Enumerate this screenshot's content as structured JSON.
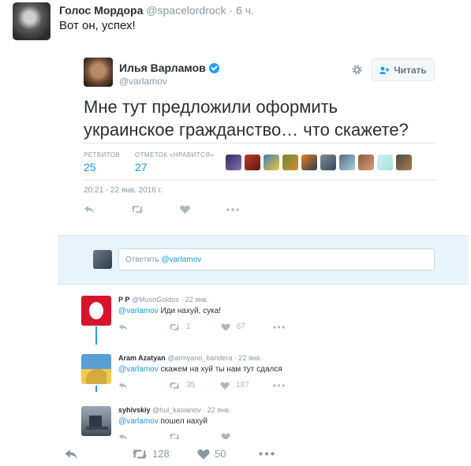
{
  "outer_tweet": {
    "name": "Голос Мордора",
    "handle": "@spacelordrock",
    "time": "· 6 ч.",
    "text": "Вот он, успех!",
    "retweets": "128",
    "likes": "50"
  },
  "embedded": {
    "author_name": "Илья Варламов",
    "author_handle": "@varlamov",
    "follow_label": "Читать",
    "text": "Мне тут предложили оформить украинское гражданство… что скажете?",
    "retweets_label": "РЕТВИТОВ",
    "retweets_value": "25",
    "likes_label": "ОТМЕТОК «НРАВИТСЯ»",
    "likes_value": "27",
    "timestamp": "20:21 - 22 янв. 2016 г.",
    "composer_prefix": "Ответить ",
    "composer_mention": "@varlamov"
  },
  "replies": [
    {
      "name": "Р Р",
      "handle": "@MusoGoldos · 22 янв.",
      "mention": "@varlamov",
      "text": " Иди нахуй, сука!",
      "retweets": "1",
      "likes": "67"
    },
    {
      "name": "Aram Azatyan",
      "handle": "@armyano_bandera · 22 янв.",
      "mention": "@varlamov",
      "text": " скажем на хуй ты нам тут сдался",
      "retweets": "35",
      "likes": "187"
    },
    {
      "name": "syhivskiy",
      "handle": "@hui_kasianov · 22 янв.",
      "mention": "@varlamov",
      "text": " пошел нахуй",
      "retweets": "",
      "likes": ""
    }
  ],
  "colors": {
    "link": "#1b95e0",
    "muted": "#8899a6",
    "composer_bg": "#e8f4fb",
    "verified": "#1da1f2"
  },
  "icons": [
    "reply-icon",
    "retweet-icon",
    "like-icon",
    "more-icon",
    "gear-icon",
    "follow-icon",
    "verified-icon"
  ]
}
